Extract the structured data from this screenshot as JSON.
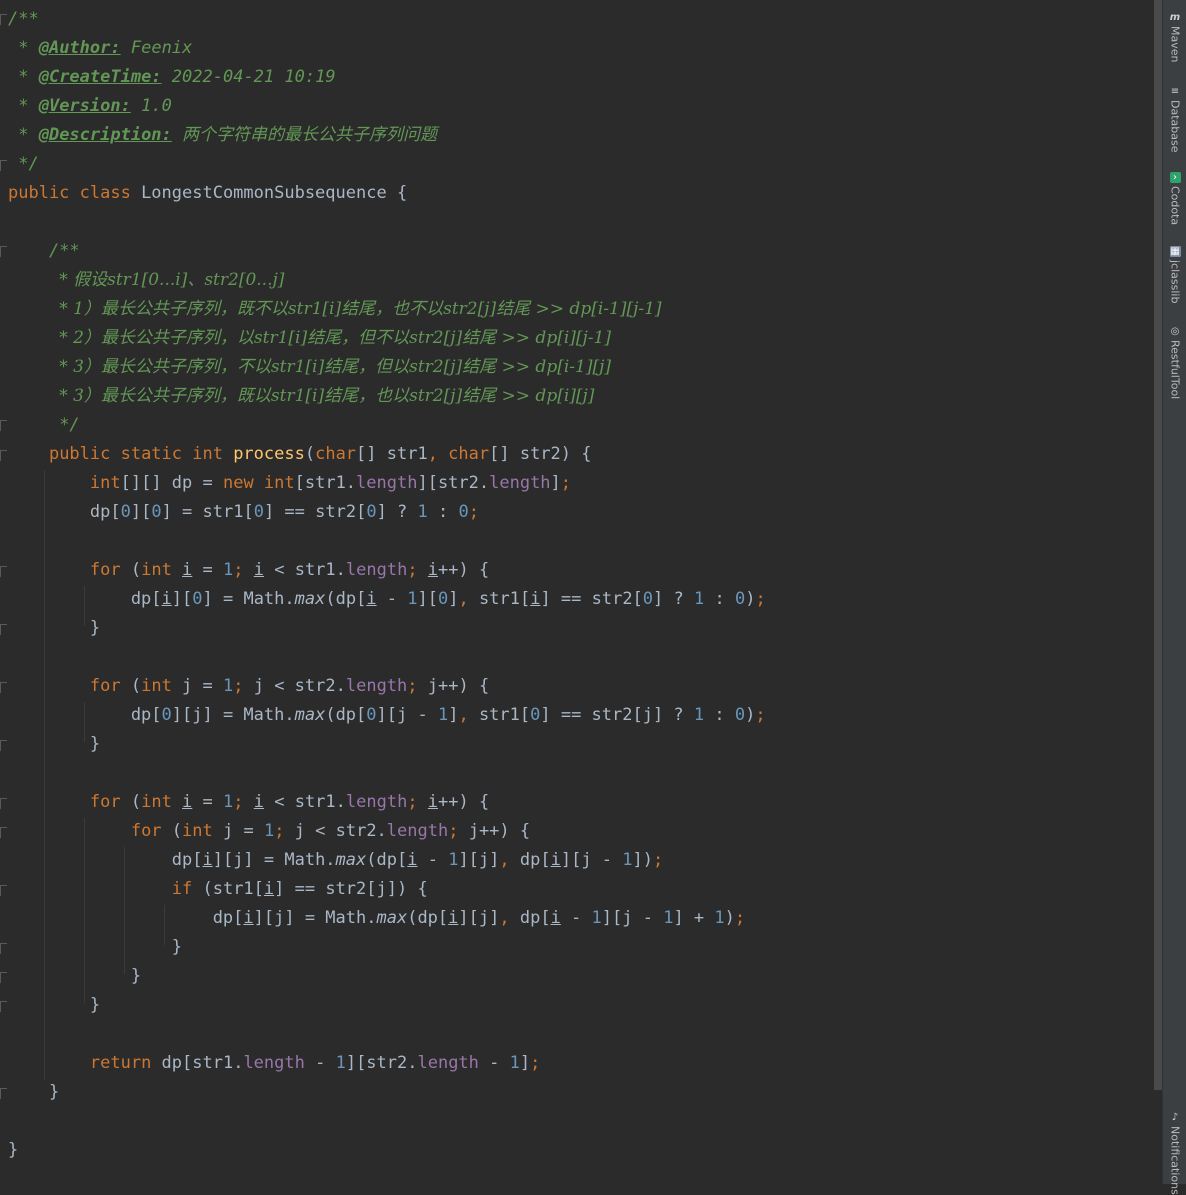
{
  "code": {
    "doc_open": "/**",
    "author_tag": "@Author:",
    "author_value": "Feenix",
    "createtime_tag": "@CreateTime:",
    "createtime_value": "2022-04-21 10:19",
    "version_tag": "@Version:",
    "version_value": "1.0",
    "description_tag": "@Description:",
    "description_value": "两个字符串的最长公共子序列问题",
    "doc_close": "*/",
    "class_name": "LongestCommonSubsequence",
    "method_doc_open": "/**",
    "method_doc_lines": [
      "* 假设str1[0...i]、str2[0...j]",
      "* 1）最长公共子序列，既不以str1[i]结尾，也不以str2[j]结尾 >> dp[i-1][j-1]",
      "* 2）最长公共子序列，以str1[i]结尾，但不以str2[j]结尾 >> dp[i][j-1]",
      "* 3）最长公共子序列，不以str1[i]结尾，但以str2[j]结尾 >> dp[i-1][j]",
      "* 3）最长公共子序列，既以str1[i]结尾，也以str2[j]结尾 >> dp[i][j]"
    ],
    "method_doc_close": "*/",
    "method_name": "process"
  },
  "tool_windows": [
    {
      "label": "Maven",
      "icon": "maven-icon"
    },
    {
      "label": "Database",
      "icon": "database-icon"
    },
    {
      "label": "Codota",
      "icon": "codota-icon"
    },
    {
      "label": "jclasslib",
      "icon": "jclasslib-icon"
    },
    {
      "label": "RestfulTool",
      "icon": "restful-icon"
    },
    {
      "label": "Notifications",
      "icon": "bell-icon"
    }
  ],
  "colors": {
    "background": "#2b2b2b",
    "keyword": "#cc7832",
    "number": "#6897bb",
    "field": "#9876aa",
    "method": "#ffc66d",
    "doc_comment": "#629755",
    "text": "#a9b7c6"
  }
}
